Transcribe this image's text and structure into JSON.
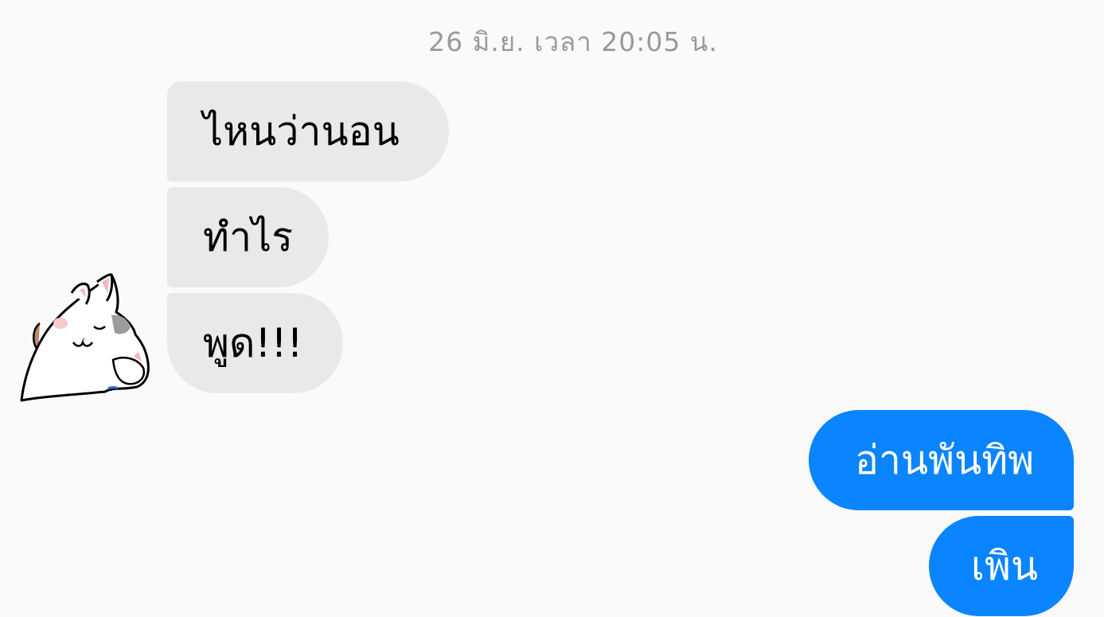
{
  "chat": {
    "timestamp": "26 มิ.ย. เวลา 20:05 น.",
    "incoming": [
      {
        "text": "ไหนว่านอน"
      },
      {
        "text": "ทำไร"
      },
      {
        "text": "พูด!!!"
      }
    ],
    "outgoing": [
      {
        "text": "อ่านพันทิพ"
      },
      {
        "text": "เพิน"
      }
    ],
    "avatar": {
      "icon": "sleeping-cat-sticker"
    },
    "colors": {
      "background": "#fafafa",
      "incoming_bubble": "#e9e9e9",
      "outgoing_bubble": "#0a84ff",
      "timestamp_text": "#9a9a9a"
    }
  }
}
